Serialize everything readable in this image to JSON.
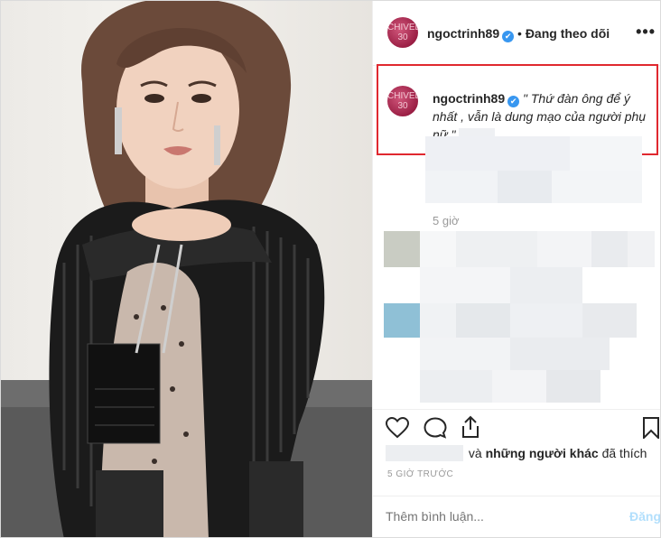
{
  "header": {
    "avatar_text_1": "CHIVEL",
    "avatar_text_2": "30",
    "username": "ngoctrinh89",
    "verified_icon": "✔",
    "separator": "•",
    "follow_label": "Đang theo dõi",
    "more_label": "•••"
  },
  "caption": {
    "username": "ngoctrinh89",
    "text": "\" Thứ đàn ông để ý nhất , vẫn là dung mạo của người phụ nữ \""
  },
  "post_time": "5 giờ",
  "likes": {
    "suffix_plain": "và",
    "suffix_bold": "những người khác",
    "suffix_end": "đã thích"
  },
  "posted_ago": "5 GIỜ TRƯỚC",
  "comment": {
    "placeholder": "Thêm bình luận...",
    "post_label": "Đăng"
  },
  "colors": {
    "highlight_border": "#e0282f",
    "verified": "#3897f0",
    "post_disabled": "#b2dffc"
  }
}
